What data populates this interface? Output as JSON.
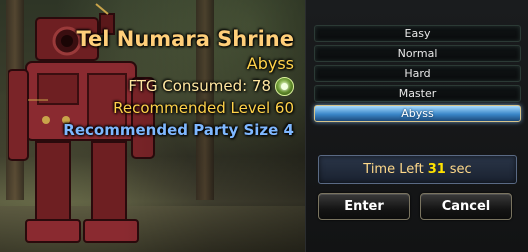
{
  "dungeon": {
    "name": "Tel Numara Shrine",
    "selected_difficulty": "Abyss",
    "ftg_consumed": "FTG Consumed: 78",
    "recommended_level": "Recommended Level 60",
    "recommended_party_size": "Recommended Party Size 4"
  },
  "difficulties": [
    {
      "label": "Easy",
      "selected": false
    },
    {
      "label": "Normal",
      "selected": false
    },
    {
      "label": "Hard",
      "selected": false
    },
    {
      "label": "Master",
      "selected": false
    },
    {
      "label": "Abyss",
      "selected": true
    }
  ],
  "timer": {
    "label": "Time Left",
    "value": "31",
    "unit": "sec"
  },
  "buttons": {
    "enter": "Enter",
    "cancel": "Cancel"
  },
  "icons": {
    "ftg": "fatigue-orb-icon"
  },
  "colors": {
    "title": "#ffcf7a",
    "difficulty_text": "#ffd24a",
    "party_size": "#7fb8ff",
    "selected_difficulty_bg": "#3a86c8",
    "timer_value": "#ffe200"
  }
}
